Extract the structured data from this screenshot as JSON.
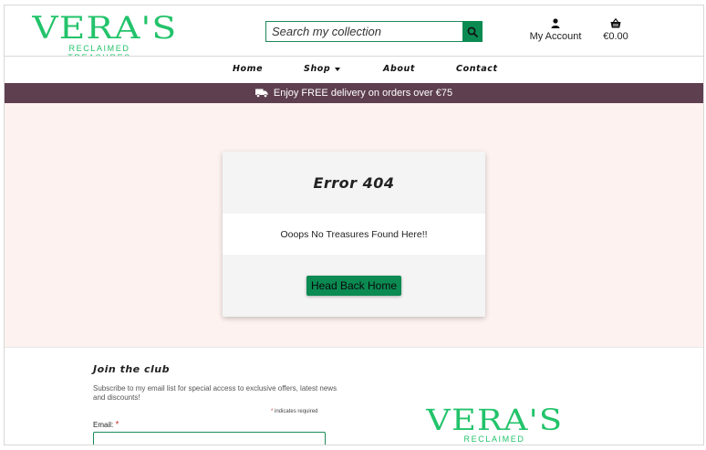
{
  "header": {
    "logo_word": "VERA'S",
    "logo_tag": "RECLAIMED TREASURES",
    "search_placeholder": "Search my collection",
    "account_label": "My Account",
    "cart_total": "€0.00"
  },
  "nav": {
    "items": [
      {
        "label": "Home"
      },
      {
        "label": "Shop"
      },
      {
        "label": "About"
      },
      {
        "label": "Contact"
      }
    ]
  },
  "banner": {
    "text": "Enjoy FREE delivery on orders over €75"
  },
  "error_card": {
    "title": "Error 404",
    "message": "Ooops No Treasures Found Here!!",
    "button_label": "Head Back Home"
  },
  "footer": {
    "join_title": "Join the club",
    "join_description": "Subscribe to my email list for special access to exclusive offers, latest news and discounts!",
    "required_note": "indicates required",
    "email_label": "Email:",
    "logo_word": "VERA'S",
    "logo_tag": "RECLAIMED TREASURES"
  },
  "colors": {
    "brand_green": "#22c36a",
    "button_green": "#0b8a52",
    "banner_plum": "#5e3f4f",
    "page_pink": "#fdf2f0"
  }
}
